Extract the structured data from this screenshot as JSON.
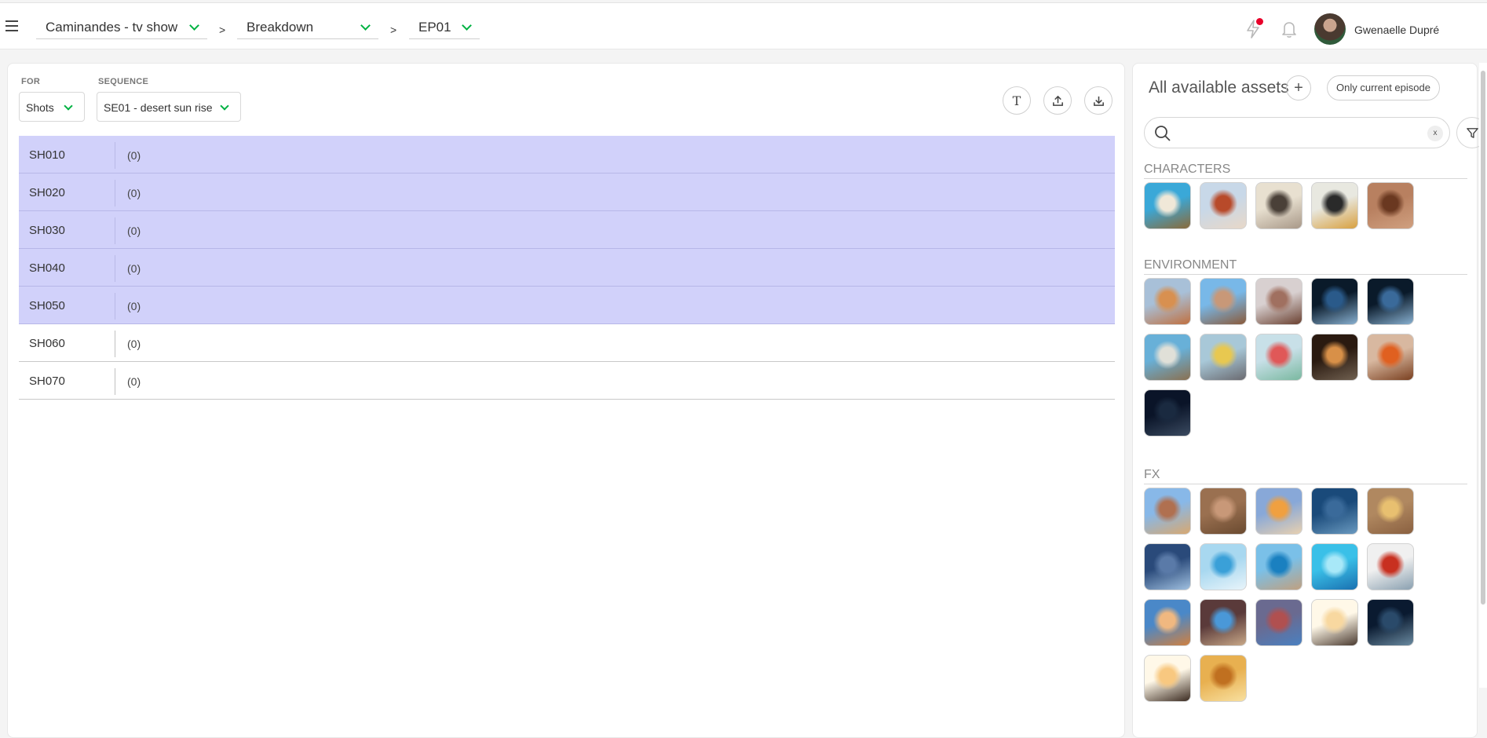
{
  "topbar": {
    "breadcrumbs": [
      "Caminandes - tv show",
      "Breakdown",
      "EP01"
    ],
    "separator": ">",
    "user_name": "Gwenaelle Dupré"
  },
  "filters": {
    "for_label": "FOR",
    "for_value": "Shots",
    "sequence_label": "SEQUENCE",
    "sequence_value": "SE01 - desert sun rise"
  },
  "toolbar": {
    "text_button": "T"
  },
  "shots": [
    {
      "name": "SH010",
      "count": "(0)",
      "selected": true
    },
    {
      "name": "SH020",
      "count": "(0)",
      "selected": true
    },
    {
      "name": "SH030",
      "count": "(0)",
      "selected": true
    },
    {
      "name": "SH040",
      "count": "(0)",
      "selected": true
    },
    {
      "name": "SH050",
      "count": "(0)",
      "selected": true
    },
    {
      "name": "SH060",
      "count": "(0)",
      "selected": false
    },
    {
      "name": "SH070",
      "count": "(0)",
      "selected": false
    }
  ],
  "assets_panel": {
    "title": "All available assets",
    "add_label": "+",
    "episode_filter": "Only current episode",
    "search_placeholder": "",
    "clear_label": "x",
    "sections": [
      {
        "title": "CHARACTERS",
        "thumbnails": [
          {
            "colors": [
              "#3aa8d8",
              "#f0e8d8",
              "#8a6a3a"
            ]
          },
          {
            "colors": [
              "#c8d8e8",
              "#b84a2a",
              "#e8d8c8"
            ]
          },
          {
            "colors": [
              "#e8e0d0",
              "#4a4038",
              "#a89888"
            ]
          },
          {
            "colors": [
              "#e8e8e0",
              "#2a2a2a",
              "#d8a040"
            ]
          },
          {
            "colors": [
              "#b88060",
              "#6a3820",
              "#d0a080"
            ]
          }
        ]
      },
      {
        "title": "ENVIRONMENT",
        "thumbnails": [
          {
            "colors": [
              "#a8c0d8",
              "#d89050",
              "#c07040"
            ]
          },
          {
            "colors": [
              "#78b8e8",
              "#c89878",
              "#8a5a3a"
            ]
          },
          {
            "colors": [
              "#d8d0d0",
              "#a07060",
              "#6a4030"
            ]
          },
          {
            "colors": [
              "#0a1a2a",
              "#2a5a8a",
              "#88b0d0"
            ]
          },
          {
            "colors": [
              "#0a1a2a",
              "#3a6a9a",
              "#88b0d0"
            ]
          },
          {
            "colors": [
              "#68b0d8",
              "#e0e0d8",
              "#8a7050"
            ]
          },
          {
            "colors": [
              "#a8c8d8",
              "#e8c850",
              "#6a6a70"
            ]
          },
          {
            "colors": [
              "#c8e0e8",
              "#e05858",
              "#7ab8a0"
            ]
          },
          {
            "colors": [
              "#2a1a10",
              "#d89048",
              "#706050"
            ]
          },
          {
            "colors": [
              "#d8b8a0",
              "#e06020",
              "#7a4020"
            ]
          },
          {
            "colors": [
              "#0a1428",
              "#1a2a40",
              "#3a4a60"
            ]
          }
        ]
      },
      {
        "title": "FX",
        "thumbnails": [
          {
            "colors": [
              "#88b8e8",
              "#b07050",
              "#d8a870"
            ]
          },
          {
            "colors": [
              "#9a7050",
              "#c89878",
              "#6a4a30"
            ]
          },
          {
            "colors": [
              "#88a8d8",
              "#f0a040",
              "#e8d0b0"
            ]
          },
          {
            "colors": [
              "#1a4a7a",
              "#3a6a9a",
              "#6a9ac0"
            ]
          },
          {
            "colors": [
              "#b08860",
              "#e8c070",
              "#8a6040"
            ]
          },
          {
            "colors": [
              "#2a4a7a",
              "#5a7aa8",
              "#a0c0e0"
            ]
          },
          {
            "colors": [
              "#a8d8f0",
              "#3aa0d8",
              "#e8f4fa"
            ]
          },
          {
            "colors": [
              "#7ac0e8",
              "#1a80c0",
              "#c0a080"
            ]
          },
          {
            "colors": [
              "#3ac0e8",
              "#a8e8f8",
              "#1a70b0"
            ]
          },
          {
            "colors": [
              "#f0f0f0",
              "#c83020",
              "#8aa0b0"
            ]
          },
          {
            "colors": [
              "#4a88c8",
              "#f0b880",
              "#d08040"
            ]
          },
          {
            "colors": [
              "#5a3a3a",
              "#4a98d8",
              "#c8a888"
            ]
          },
          {
            "colors": [
              "#6a6a90",
              "#b05050",
              "#4a80c0"
            ]
          },
          {
            "colors": [
              "#fff8e8",
              "#f8d8a0",
              "#4a3a30"
            ]
          },
          {
            "colors": [
              "#0a1a30",
              "#2a4a6a",
              "#6a8aa0"
            ]
          },
          {
            "colors": [
              "#fff8e8",
              "#f8c880",
              "#3a2a20"
            ]
          },
          {
            "colors": [
              "#e8b050",
              "#c07020",
              "#f8e0a0"
            ]
          }
        ]
      }
    ]
  }
}
